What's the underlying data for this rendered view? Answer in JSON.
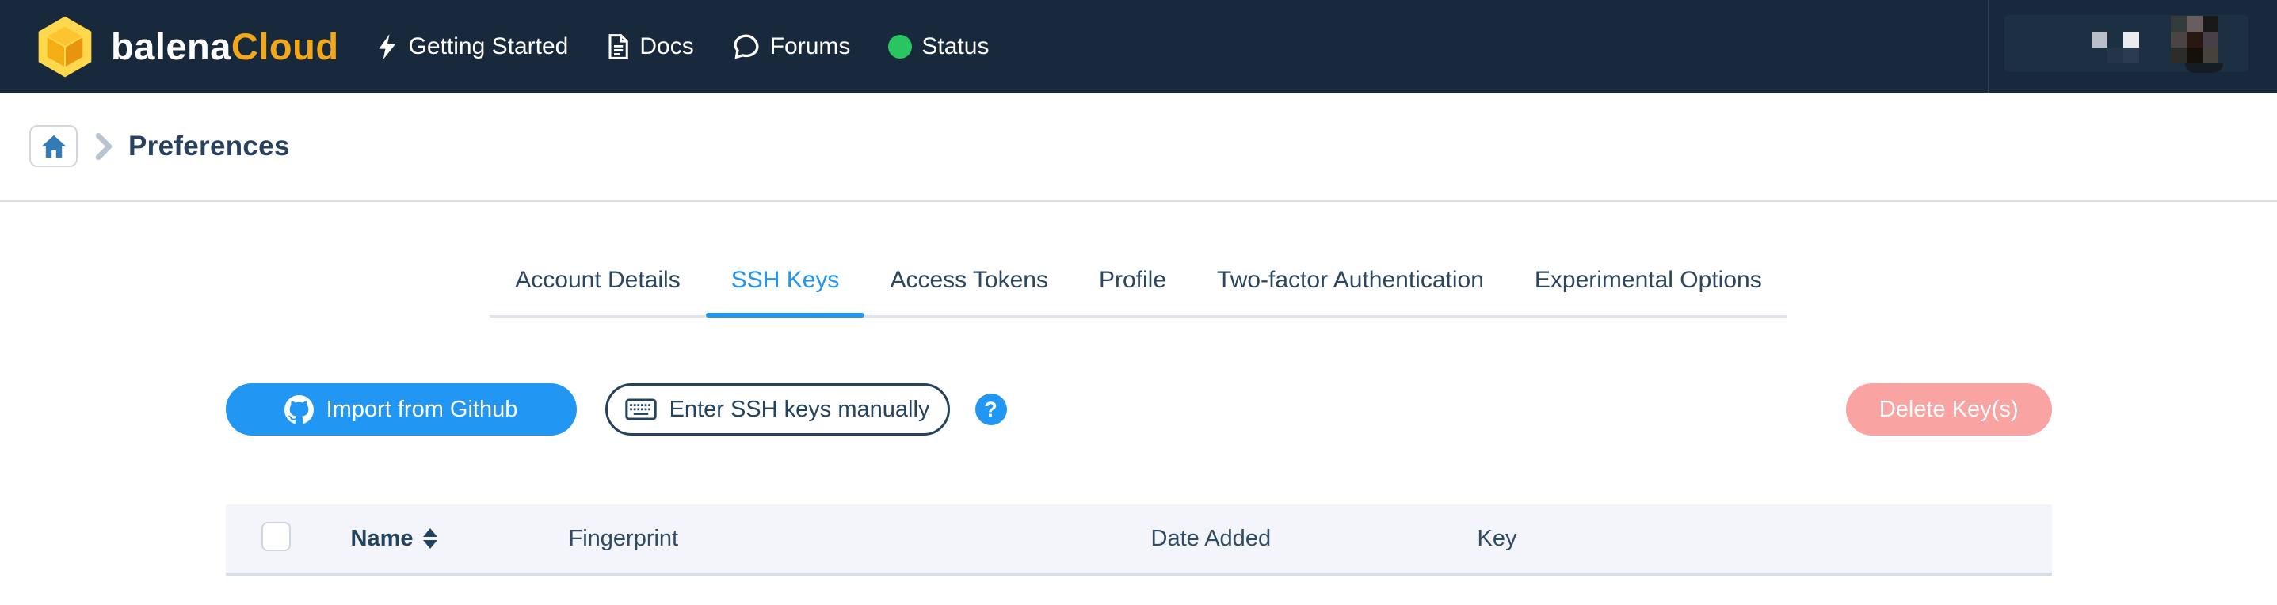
{
  "colors": {
    "navbar_bg": "#18293b",
    "accent_blue": "#2196f3",
    "brand_yellow": "#f3a71b",
    "navy_text": "#23445e",
    "danger_pink": "#f9a3a3",
    "status_green": "#2bc463",
    "table_header_bg": "#f4f5fa"
  },
  "navbar": {
    "brand": {
      "first": "balena",
      "second": "Cloud"
    },
    "items": [
      {
        "label": "Getting Started",
        "icon": "lightning-icon"
      },
      {
        "label": "Docs",
        "icon": "docs-icon"
      },
      {
        "label": "Forums",
        "icon": "forums-icon"
      },
      {
        "label": "Status",
        "icon": "status-dot-icon"
      }
    ]
  },
  "breadcrumb": {
    "current": "Preferences"
  },
  "tabs": {
    "active": "SSH Keys",
    "items": [
      {
        "label": "Account Details"
      },
      {
        "label": "SSH Keys"
      },
      {
        "label": "Access Tokens"
      },
      {
        "label": "Profile"
      },
      {
        "label": "Two-factor Authentication"
      },
      {
        "label": "Experimental Options"
      }
    ]
  },
  "toolbar": {
    "import_github_label": "Import from Github",
    "enter_manually_label": "Enter SSH keys manually",
    "help_glyph": "?",
    "delete_label": "Delete Key(s)"
  },
  "table": {
    "columns": [
      {
        "label": "Name",
        "sortable": true
      },
      {
        "label": "Fingerprint"
      },
      {
        "label": "Date Added"
      },
      {
        "label": "Key"
      }
    ],
    "rows": []
  }
}
